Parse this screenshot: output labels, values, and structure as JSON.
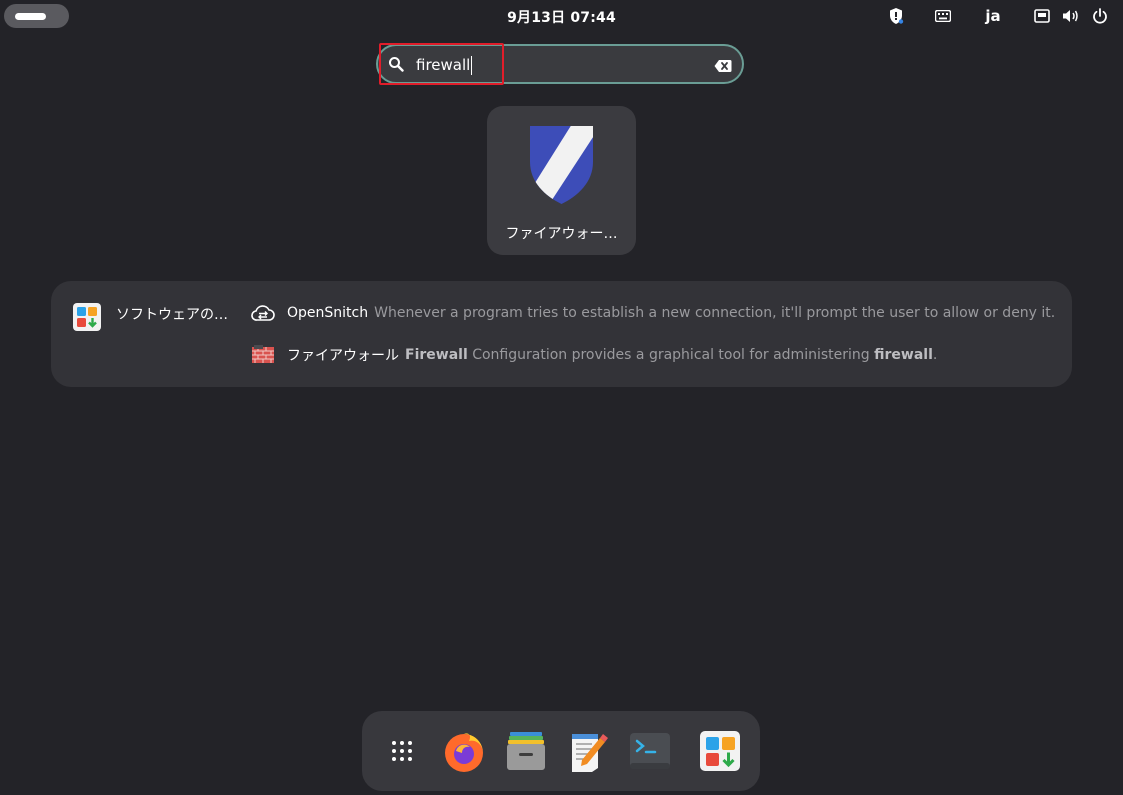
{
  "topbar": {
    "clock": "9月13日  07:44",
    "language": "ja"
  },
  "search": {
    "query": "firewall"
  },
  "app_grid": {
    "tiles": [
      {
        "label": "ファイアウォー…",
        "icon": "firewall-shield-icon"
      }
    ]
  },
  "results": {
    "provider": {
      "label": "ソフトウェアの…",
      "icon": "software-app-icon"
    },
    "items": [
      {
        "name": "OpenSnitch",
        "description": "Whenever a program tries to establish a new connection, it'll prompt the user to allow or deny it.",
        "icon": "opensnitch-icon"
      },
      {
        "name": "ファイアウォール",
        "desc_part1": "Firewall",
        "desc_part2": " Configuration provides a graphical tool for administering ",
        "desc_part3": "firewall",
        "desc_part4": ".",
        "icon": "firewall-brick-icon"
      }
    ]
  },
  "dock": {
    "items": [
      "app-grid-icon",
      "firefox-icon",
      "files-icon",
      "text-editor-icon",
      "terminal-icon",
      "software-icon"
    ]
  },
  "colors": {
    "background": "#232328",
    "search_border": "#6a9d95",
    "highlight": "#e11d2a",
    "panel": "#333338"
  }
}
